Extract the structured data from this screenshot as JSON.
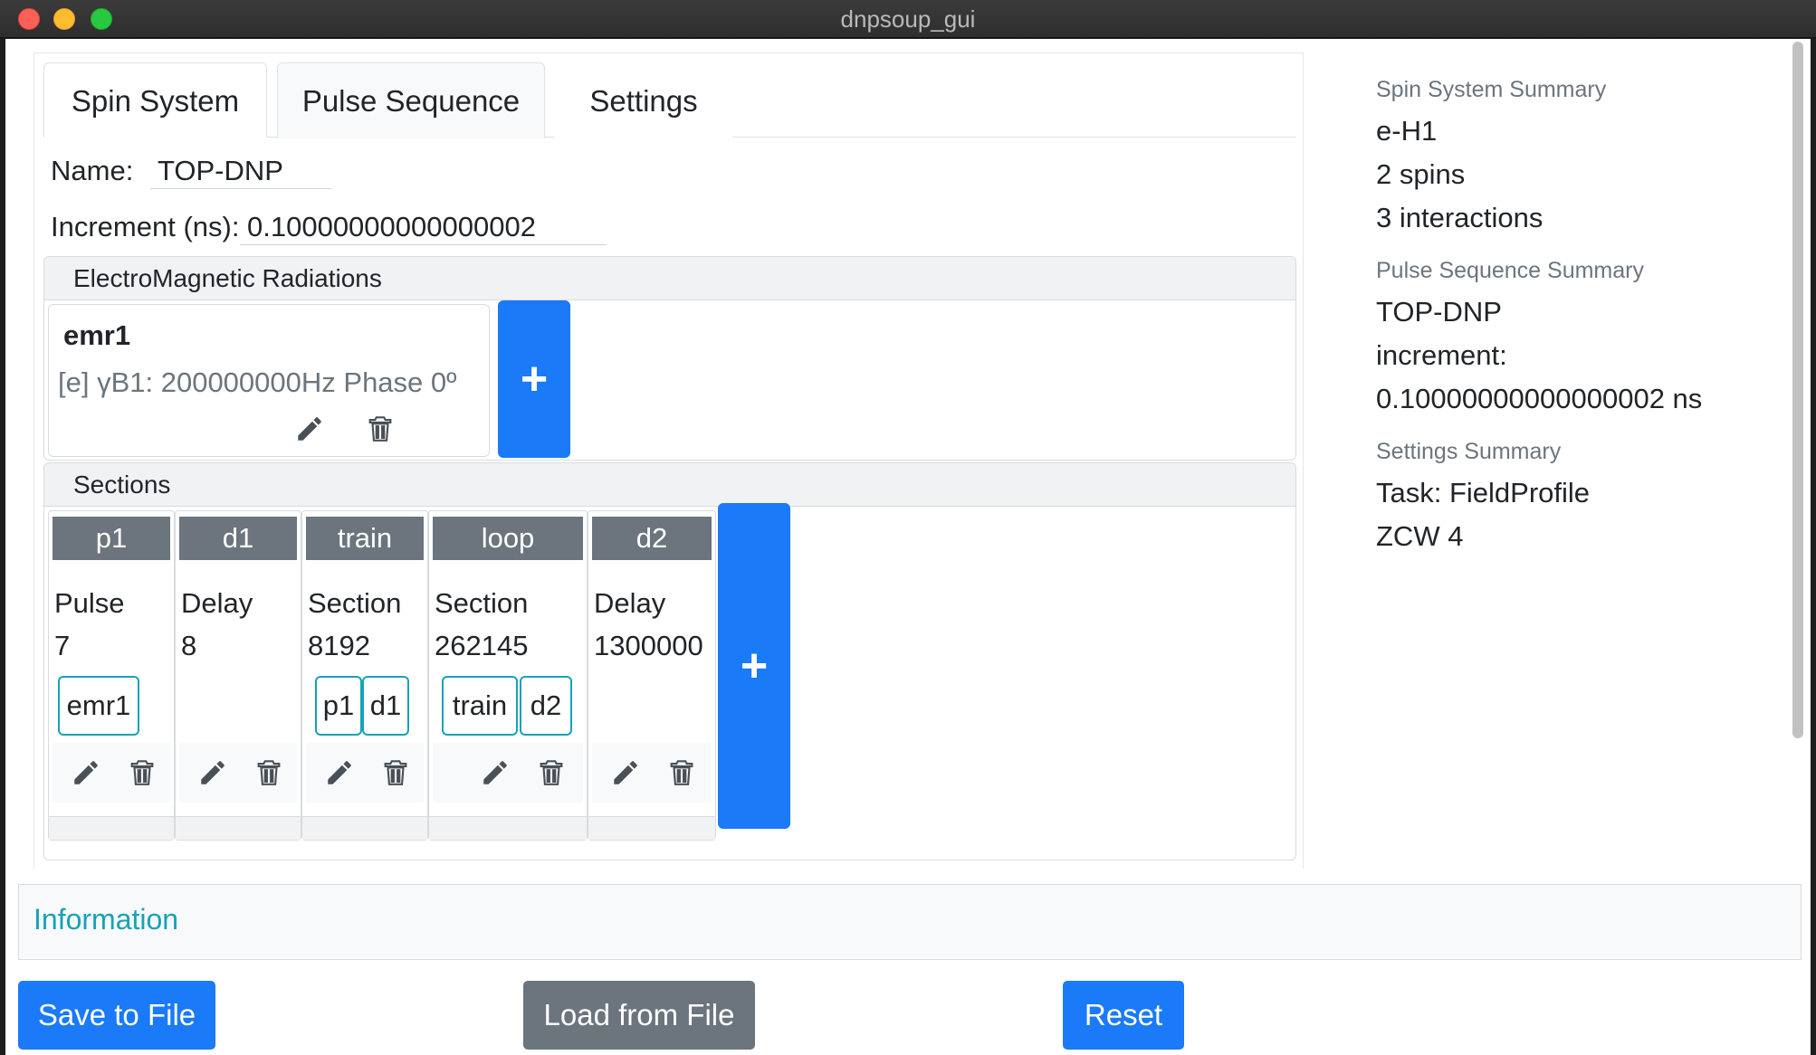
{
  "window": {
    "title": "dnpsoup_gui"
  },
  "tabs": [
    {
      "label": "Spin System",
      "active": false
    },
    {
      "label": "Pulse Sequence",
      "active": true
    },
    {
      "label": "Settings",
      "active": false
    }
  ],
  "form": {
    "name_label": "Name:",
    "name_value": "TOP-DNP",
    "increment_label": "Increment (ns):",
    "increment_value": "0.10000000000000002"
  },
  "emr_card": {
    "header": "ElectroMagnetic Radiations",
    "items": [
      {
        "name": "emr1",
        "description": "[e] γB1: 200000000Hz Phase 0º"
      }
    ],
    "add_label": "+"
  },
  "sections_card": {
    "header": "Sections",
    "items": [
      {
        "name": "p1",
        "type": "Pulse",
        "value": "7",
        "children": [
          "emr1"
        ]
      },
      {
        "name": "d1",
        "type": "Delay",
        "value": "8",
        "children": []
      },
      {
        "name": "train",
        "type": "Section",
        "value": "8192",
        "children": [
          "p1",
          "d1"
        ]
      },
      {
        "name": "loop",
        "type": "Section",
        "value": "262145",
        "children": [
          "train",
          "d2"
        ]
      },
      {
        "name": "d2",
        "type": "Delay",
        "value": "1300000",
        "children": []
      }
    ],
    "add_label": "+"
  },
  "summary": {
    "spin_label": "Spin System Summary",
    "spin_lines": [
      "e-H1",
      "2 spins",
      "3 interactions"
    ],
    "pulse_label": "Pulse Sequence Summary",
    "pulse_lines": [
      "TOP-DNP",
      "increment:",
      "0.10000000000000002 ns"
    ],
    "settings_label": "Settings Summary",
    "settings_lines": [
      "Task: FieldProfile",
      "ZCW 4"
    ]
  },
  "information": {
    "label": "Information"
  },
  "buttons": {
    "save": "Save to File",
    "load": "Load from File",
    "reset": "Reset"
  },
  "colors": {
    "primary": "#1a7af8",
    "secondary": "#6c757d",
    "info": "#17a2b8"
  },
  "icons": {
    "edit": "pencil-icon",
    "delete": "trash-icon"
  }
}
